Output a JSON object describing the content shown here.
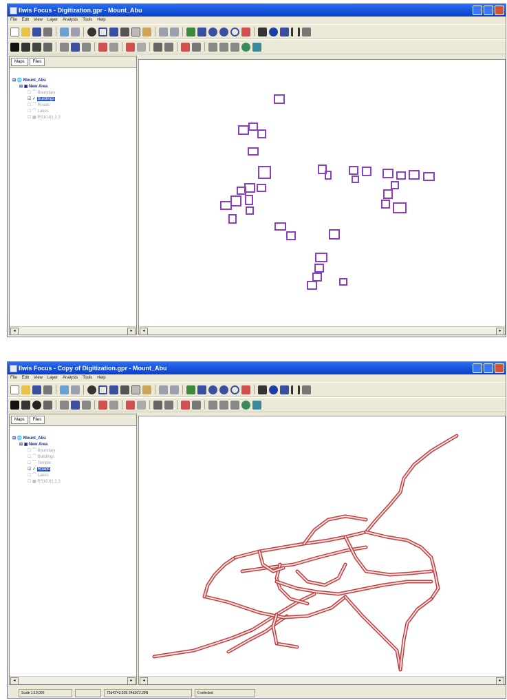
{
  "windows": [
    {
      "title": "Ilwis Focus - Digitization.gpr - Mount_Abu",
      "menu": [
        "File",
        "Edit",
        "View",
        "Layer",
        "Analysis",
        "Tools",
        "Help"
      ],
      "tabs": [
        "Maps",
        "Files"
      ],
      "tree": {
        "root": "Mount_Abu",
        "group": "New Area",
        "layers": [
          "Boundary",
          "Buildings",
          "Roads",
          "Lakes",
          "RS10.61.2.3"
        ],
        "selected_layer": "Buildings"
      }
    },
    {
      "title": "Ilwis Focus - Copy of Digitization.gpr - Mount_Abu",
      "menu": [
        "File",
        "Edit",
        "View",
        "Layer",
        "Analysis",
        "Tools",
        "Help"
      ],
      "tabs": [
        "Maps",
        "Files"
      ],
      "tree": {
        "root": "Mount_Abu",
        "group": "New Area",
        "layers": [
          "Boundary",
          "Buildings",
          "Temple",
          "Roads",
          "Lakes",
          "RS10.61.2.3"
        ],
        "selected_layer": "Roads"
      },
      "status": {
        "scale": "Scale 1:10,000",
        "coords": "72d42'43.52E  24d36'2.28N",
        "selected": "0 selected"
      }
    }
  ],
  "colors": {
    "titlebar": "#0a3fc9",
    "building_outline": "#8a3fc0",
    "road_outline": "#c04040",
    "selection": "#2b57c9"
  },
  "icons": [
    "new-icon",
    "open-icon",
    "save-icon",
    "print-icon",
    "zoom-in-icon",
    "zoom-out-icon",
    "pan-icon",
    "identify-icon",
    "info-icon",
    "select-arrow-icon",
    "text-icon"
  ]
}
